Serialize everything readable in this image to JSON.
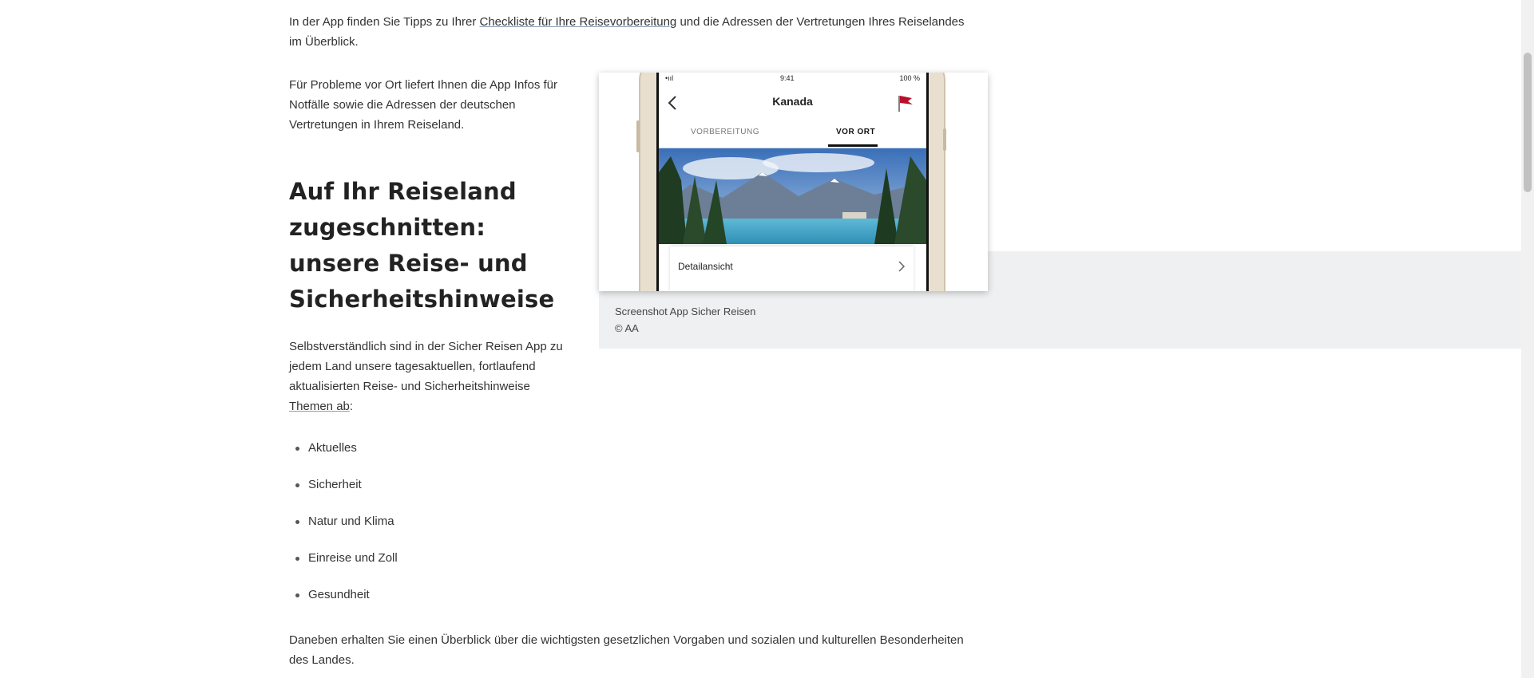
{
  "article": {
    "intro_before": "In der App finden Sie Tipps zu Ihrer ",
    "intro_link": "Checkliste für Ihre Reisevorbereitung",
    "intro_after": " und die Adressen der Vertretungen Ihres Reiselandes im Überblick.",
    "problems_text": "Für Probleme vor Ort liefert Ihnen die App Infos für Notfälle sowie die Adressen der deutschen Vertretungen in Ihrem Reiseland.",
    "heading": "Auf Ihr Reiseland zugeschnitten: unsere Reise- und Sicherheitshinweise",
    "info_before": "Selbstverständlich sind in der Sicher Reisen App zu jedem Land unsere tagesaktuellen, fortlaufend aktualisierten Reise- und Sicherheitshinweise ",
    "info_link": "Themen ab",
    "info_after": ":",
    "hints": [
      "Aktuelles",
      "Sicherheit",
      "Natur und Klima",
      "Einreise und Zoll",
      "Gesundheit"
    ],
    "closing": "Daneben erhalten Sie einen Überblick über die wichtigsten gesetzlichen Vorgaben und sozialen und kulturellen Besonderheiten des Landes."
  },
  "figure": {
    "caption_title": "Screenshot App Sicher Reisen",
    "caption_copyright": "© AA",
    "phone": {
      "status_left": "•ııl",
      "status_time": "9:41",
      "status_battery": "100 %",
      "country": "Kanada",
      "tabs": [
        "VORBEREITUNG",
        "VOR ORT"
      ],
      "active_tab": "VOR ORT",
      "detail_label": "Detailansicht"
    }
  },
  "colors": {
    "caption_background": "#eef0f2",
    "flag_red": "#b8102a"
  }
}
